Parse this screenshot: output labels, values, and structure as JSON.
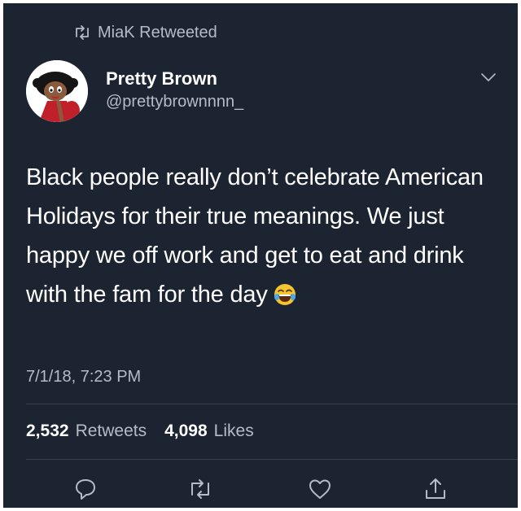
{
  "retweet_context": {
    "icon": "retweet-icon",
    "label": "MiaK Retweeted"
  },
  "author": {
    "name": "Pretty Brown",
    "handle": "@prettybrownnnn_",
    "avatar": "cartoon-avatar"
  },
  "tweet": {
    "text": "Black people really don’t celebrate American Holidays for their true meanings. We just happy we off work and get to eat and drink with the fam for the day",
    "emoji": "😂",
    "timestamp": "7/1/18, 7:23 PM"
  },
  "stats": {
    "retweets_count": "2,532",
    "retweets_label": "Retweets",
    "likes_count": "4,098",
    "likes_label": "Likes"
  },
  "actions": [
    "reply-icon",
    "retweet-icon",
    "like-icon",
    "share-icon"
  ],
  "colors": {
    "background": "#1c2331",
    "text": "#ffffff",
    "secondary": "#b5bcc7",
    "divider": "#38404e"
  }
}
